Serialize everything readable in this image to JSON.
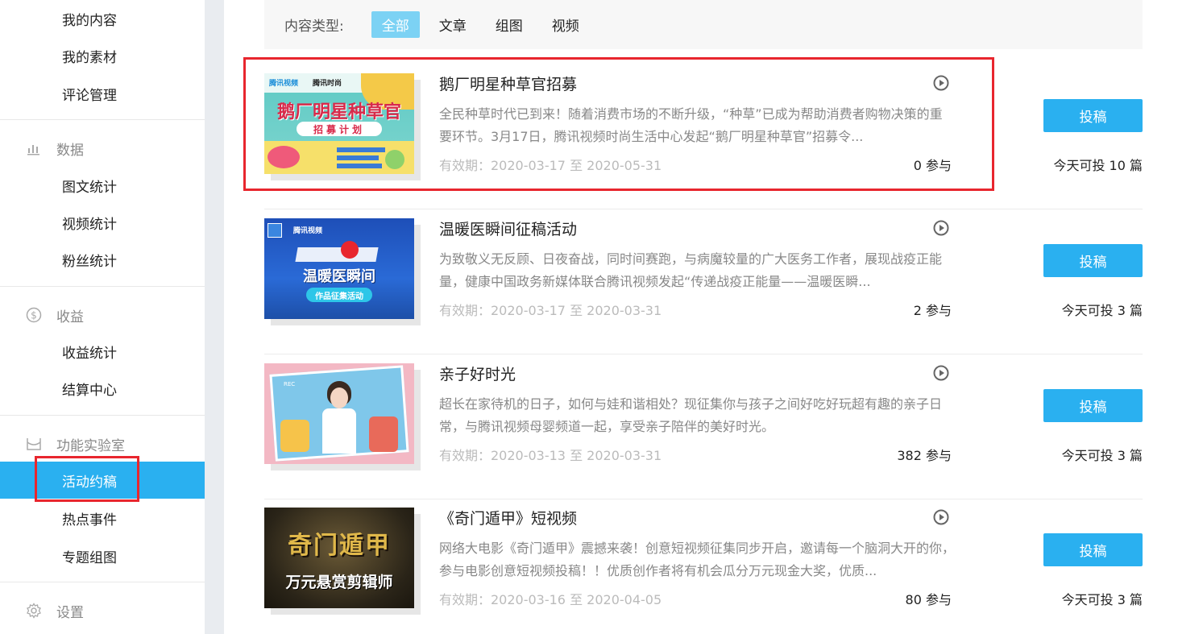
{
  "sidebar": {
    "top_items": [
      {
        "label": "我的内容"
      },
      {
        "label": "我的素材"
      },
      {
        "label": "评论管理"
      }
    ],
    "groups": [
      {
        "label": "数据",
        "icon": "bar-chart-icon",
        "items": [
          {
            "label": "图文统计"
          },
          {
            "label": "视频统计"
          },
          {
            "label": "粉丝统计"
          }
        ]
      },
      {
        "label": "收益",
        "icon": "dollar-circle-icon",
        "items": [
          {
            "label": "收益统计"
          },
          {
            "label": "结算中心"
          }
        ]
      },
      {
        "label": "功能实验室",
        "icon": "lab-icon",
        "items": [
          {
            "label": "活动约稿",
            "active": true
          },
          {
            "label": "热点事件"
          },
          {
            "label": "专题组图"
          }
        ]
      },
      {
        "label": "设置",
        "icon": "gear-icon",
        "items": []
      }
    ]
  },
  "filter": {
    "label": "内容类型:",
    "tabs": [
      {
        "label": "全部",
        "active": true
      },
      {
        "label": "文章"
      },
      {
        "label": "组图"
      },
      {
        "label": "视频"
      }
    ]
  },
  "cards": [
    {
      "title": "鹅厂明星种草官招募",
      "desc": "全民种草时代已到来！随着消费市场的不断升级，“种草”已成为帮助消费者购物决策的重要环节。3月17日，腾讯视频时尚生活中心发起“鹅厂明星种草官”招募令...",
      "validity": "有效期：2020-03-17 至 2020-05-31",
      "participants": "0 参与",
      "submit_label": "投稿",
      "quota": "今天可投 10 篇",
      "thumb_text": "鹅厂明星种草官",
      "thumb_sub": "招募计划",
      "thumb_logo1": "腾讯视频",
      "thumb_logo2": "腾讯时尚"
    },
    {
      "title": "温暖医瞬间征稿活动",
      "desc": "为致敬义无反顾、日夜奋战，同时间赛跑，与病魔较量的广大医务工作者，展现战疫正能量，健康中国政务新媒体联合腾讯视频发起“传递战疫正能量——温暖医瞬...",
      "validity": "有效期：2020-03-17 至 2020-03-31",
      "participants": "2 参与",
      "submit_label": "投稿",
      "quota": "今天可投 3 篇",
      "thumb_text": "温暖医瞬间",
      "thumb_sub": "作品征集活动",
      "thumb_logo1": "腾讯视频"
    },
    {
      "title": "亲子好时光",
      "desc": "超长在家待机的日子，如何与娃和谐相处？现征集你与孩子之间好吃好玩超有趣的亲子日常，与腾讯视频母婴频道一起，享受亲子陪伴的美好时光。",
      "validity": "有效期：2020-03-13 至 2020-03-31",
      "participants": "382 参与",
      "submit_label": "投稿",
      "quota": "今天可投 3 篇",
      "thumb_rec": "REC"
    },
    {
      "title": "《奇门遁甲》短视频",
      "desc": "网络大电影《奇门遁甲》震撼来袭！创意短视频征集同步开启，邀请每一个脑洞大开的你，参与电影创意短视频投稿！！优质创作者将有机会瓜分万元现金大奖，优质...",
      "validity": "有效期：2020-03-16 至 2020-04-05",
      "participants": "80 参与",
      "submit_label": "投稿",
      "quota": "今天可投 3 篇",
      "thumb_text": "奇门遁甲",
      "thumb_sub": "万元悬赏剪辑师"
    }
  ],
  "colors": {
    "accent": "#2ab0f0",
    "highlight": "#e8262e"
  }
}
